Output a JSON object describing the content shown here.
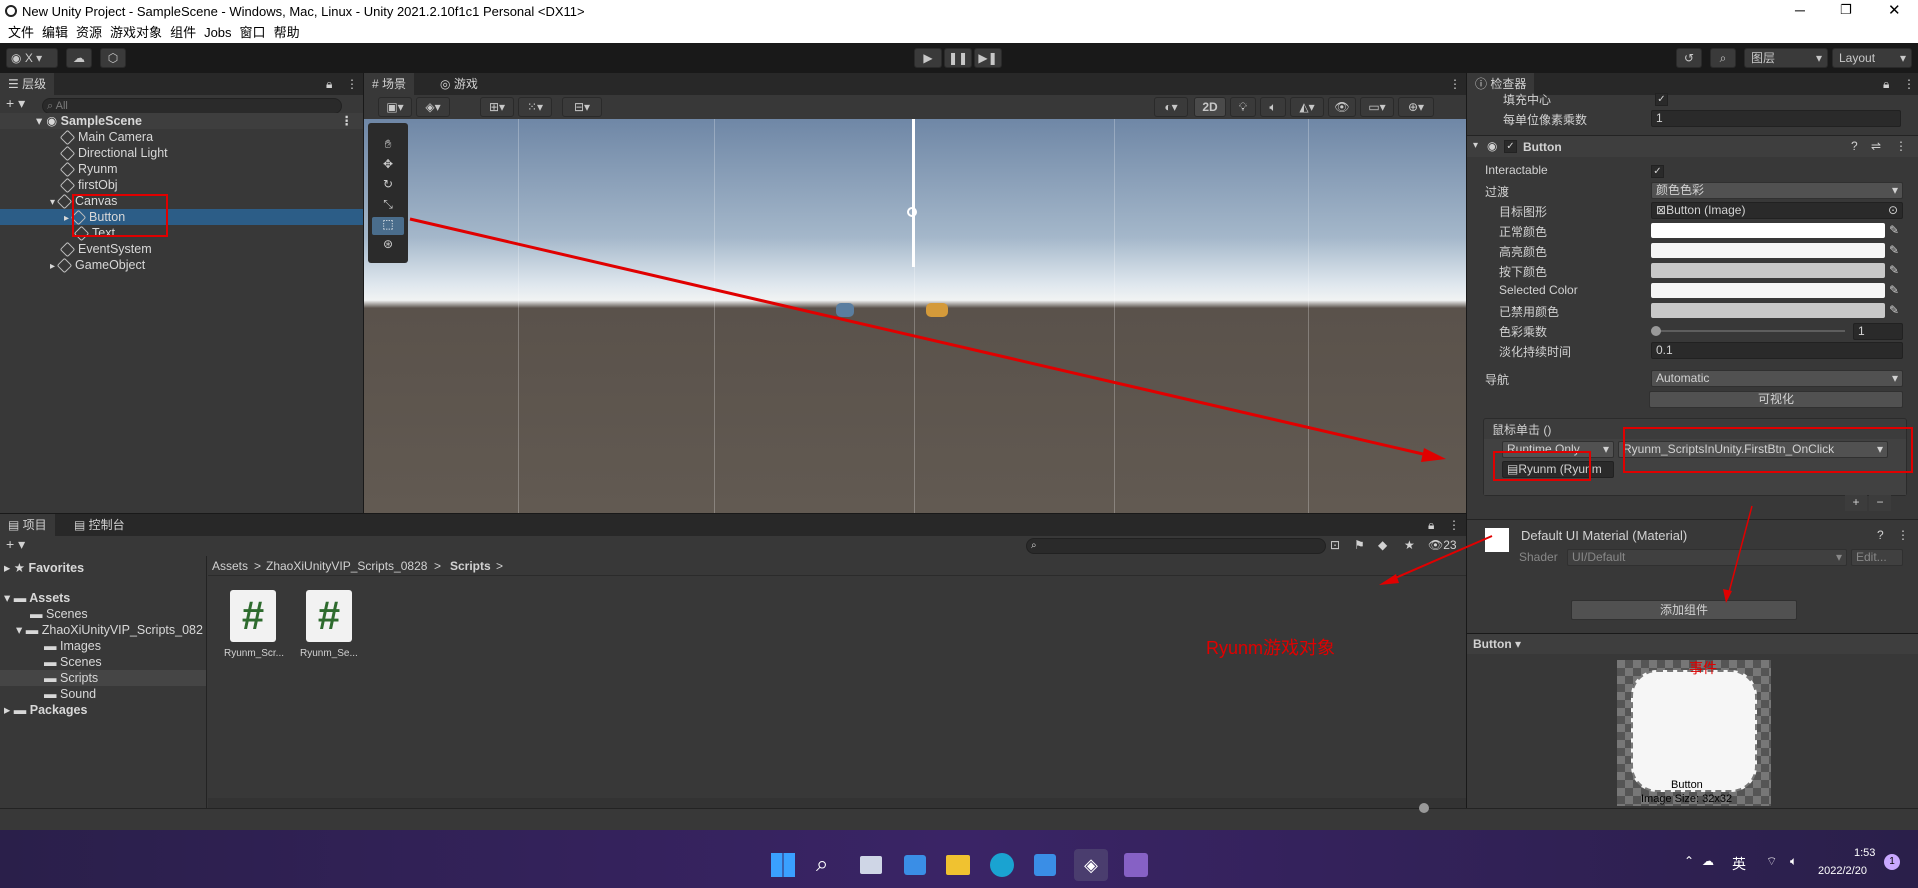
{
  "window": {
    "title": "New Unity Project - SampleScene - Windows, Mac, Linux - Unity 2021.2.10f1c1 Personal <DX11>"
  },
  "menu": [
    "文件",
    "编辑",
    "资源",
    "游戏对象",
    "组件",
    "Jobs",
    "窗口",
    "帮助"
  ],
  "toolbar": {
    "account": "X",
    "layers": "图层",
    "layout": "Layout"
  },
  "hierarchy": {
    "tab": "层级",
    "search_placeholder": "All",
    "scene": "SampleScene",
    "items": [
      "Main Camera",
      "Directional Light",
      "Ryunm",
      "firstObj",
      "Canvas",
      "Button",
      "Text",
      "EventSystem",
      "GameObject"
    ]
  },
  "scene_view": {
    "tabs": [
      "场景",
      "游戏"
    ],
    "mode_2d": "2D"
  },
  "inspector": {
    "tab": "检查器",
    "top_rows": [
      {
        "label": "填充中心"
      },
      {
        "label": "每单位像素乘数",
        "value": "1"
      }
    ],
    "component": "Button",
    "interactable": "Interactable",
    "transition_label": "过渡",
    "transition_value": "颜色色彩",
    "target_label": "目标图形",
    "target_value": "Button (Image)",
    "colors": [
      {
        "label": "正常颜色",
        "color": "#ffffff"
      },
      {
        "label": "高亮颜色",
        "color": "#f5f5f5"
      },
      {
        "label": "按下颜色",
        "color": "#c8c8c8"
      },
      {
        "label": "Selected Color",
        "color": "#f5f5f5"
      },
      {
        "label": "已禁用颜色",
        "color": "#c8c8c8"
      }
    ],
    "multiplier_label": "色彩乘数",
    "multiplier_value": "1",
    "fade_label": "淡化持续时间",
    "fade_value": "0.1",
    "nav_label": "导航",
    "nav_value": "Automatic",
    "visualize": "可视化",
    "onclick_label": "鼠标单击 ()",
    "runtime": "Runtime Only",
    "function": "Ryunm_ScriptsInUnity.FirstBtn_OnClick",
    "object": "Ryunm (Ryunm",
    "material_name": "Default UI Material (Material)",
    "shader_label": "Shader",
    "shader_value": "UI/Default",
    "edit": "Edit...",
    "add_component": "添加组件",
    "preview_title": "Button",
    "preview_name": "Button",
    "preview_size": "Image Size: 32x32",
    "annotation_event": "事件"
  },
  "project": {
    "tabs": [
      "项目",
      "控制台"
    ],
    "count": "23",
    "tree": [
      {
        "label": "Favorites",
        "bold": true
      },
      {
        "label": "Assets",
        "bold": true
      },
      {
        "label": "Scenes"
      },
      {
        "label": "ZhaoXiUnityVIP_Scripts_082"
      },
      {
        "label": "Images"
      },
      {
        "label": "Scenes"
      },
      {
        "label": "Scripts"
      },
      {
        "label": "Sound"
      },
      {
        "label": "Packages",
        "bold": true
      }
    ],
    "breadcrumb": [
      "Assets",
      "ZhaoXiUnityVIP_Scripts_0828",
      "Scripts"
    ],
    "files": [
      "Ryunm_Scr...",
      "Ryunm_Se..."
    ],
    "annotation": "Ryunm游戏对象"
  },
  "taskbar": {
    "lang": "英",
    "time": "1:53",
    "date": "2022/2/20",
    "notif": "1"
  }
}
